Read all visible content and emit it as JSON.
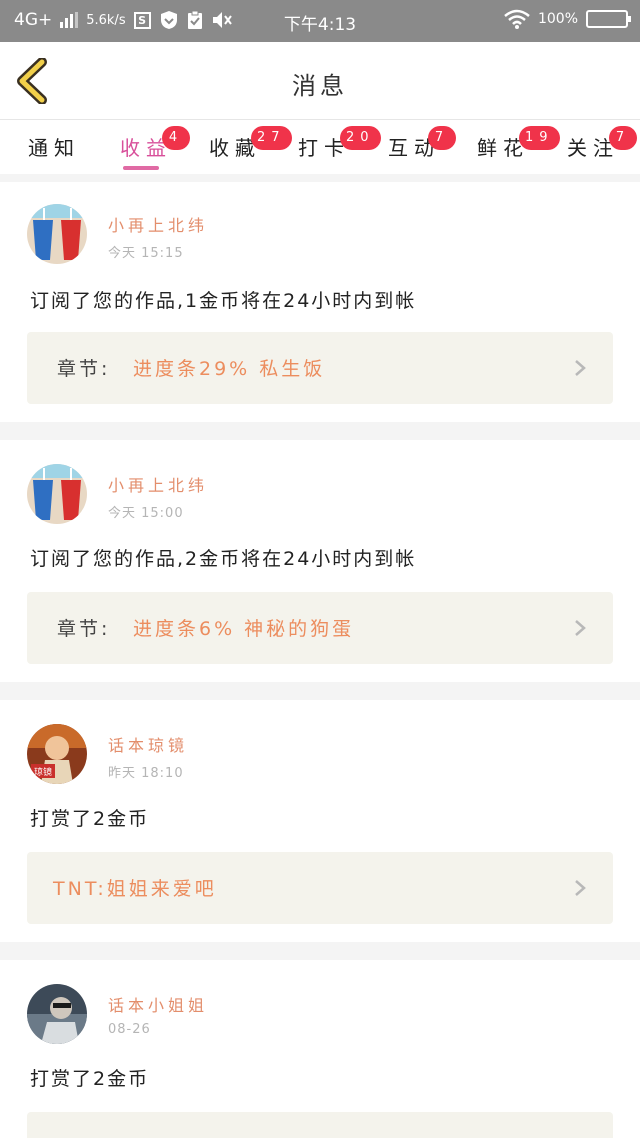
{
  "status_bar": {
    "network": "4G+",
    "speed": "5.6k/s",
    "s_icon": "S",
    "time": "下午4:13",
    "battery": "100%",
    "icons": [
      "signal-icon",
      "s-app-icon",
      "shield-icon",
      "clipboard-check-icon",
      "mute-icon",
      "wifi-icon",
      "battery-icon"
    ]
  },
  "header": {
    "title": "消息",
    "back_icon": "chevron-left-icon",
    "accent_color": "#e06aa4"
  },
  "tabs": [
    {
      "label": "通知",
      "badge": ""
    },
    {
      "label": "收益",
      "badge": "4",
      "active": true
    },
    {
      "label": "收藏",
      "badge": "27"
    },
    {
      "label": "打卡",
      "badge": "20"
    },
    {
      "label": "互动",
      "badge": "7"
    },
    {
      "label": "鲜花",
      "badge": "19"
    },
    {
      "label": "关注",
      "badge": "7"
    }
  ],
  "messages": [
    {
      "user": "小再上北纬",
      "time": "今天 15:15",
      "text": "订阅了您的作品,1金币将在24小时内到帐",
      "box_label": "章节:",
      "box_title": "进度条29% 私生饭"
    },
    {
      "user": "小再上北纬",
      "time": "今天 15:00",
      "text": "订阅了您的作品,2金币将在24小时内到帐",
      "box_label": "章节:",
      "box_title": "进度条6% 神秘的狗蛋"
    },
    {
      "user": "话本琼镜",
      "time": "昨天 18:10",
      "text": "打赏了2金币",
      "box_label": "",
      "box_title": "TNT:姐姐来爱吧",
      "avatar_text": "琼镜"
    },
    {
      "user": "话本小姐姐",
      "time": "08-26",
      "text": "打赏了2金币",
      "box_label": "",
      "box_title": ""
    }
  ]
}
